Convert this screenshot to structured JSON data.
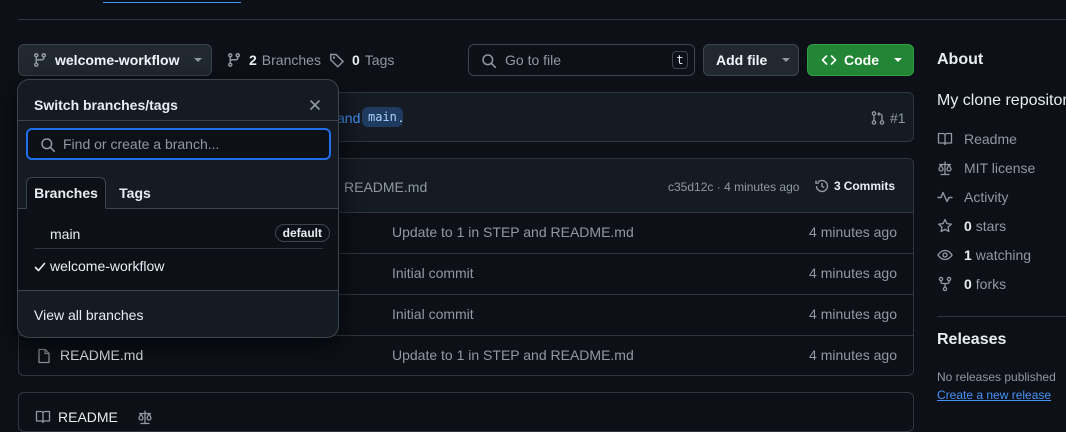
{
  "topbar": {
    "partial_link": ""
  },
  "branch_button": {
    "label": "welcome-workflow"
  },
  "branches_link": {
    "count": "2",
    "label": "Branches"
  },
  "tags_link": {
    "count": "0",
    "label": "Tags"
  },
  "search": {
    "placeholder": "Go to file",
    "shortcut": "t"
  },
  "add_file": {
    "label": "Add file"
  },
  "code_button": {
    "label": "Code"
  },
  "compare_banner": {
    "text_end": "and",
    "branch_chip": "main",
    "period": ".",
    "pr_number": "#1"
  },
  "commit_header": {
    "message_tail": "README.md",
    "hash": "c35d12c",
    "sep": "·",
    "time": "4 minutes ago",
    "commits_count": "3",
    "commits_label": "Commits"
  },
  "files": [
    {
      "name": "",
      "message": "Update to 1 in STEP and README.md",
      "time": "4 minutes ago"
    },
    {
      "name": "",
      "message": "Initial commit",
      "time": "4 minutes ago"
    },
    {
      "name": "",
      "message": "Initial commit",
      "time": "4 minutes ago"
    },
    {
      "name": "README.md",
      "message": "Update to 1 in STEP and README.md",
      "time": "4 minutes ago"
    }
  ],
  "readme_bar": {
    "label": "README"
  },
  "about": {
    "title": "About",
    "description": "My clone repositor",
    "readme": "Readme",
    "license": "MIT license",
    "activity": "Activity",
    "stars_count": "0",
    "stars_label": "stars",
    "watching_count": "1",
    "watching_label": "watching",
    "forks_count": "0",
    "forks_label": "forks"
  },
  "releases": {
    "title": "Releases",
    "none_text": "No releases published",
    "create_link": "Create a new release"
  },
  "dropdown": {
    "title": "Switch branches/tags",
    "filter_placeholder": "Find or create a branch...",
    "tabs": [
      "Branches",
      "Tags"
    ],
    "branches": [
      {
        "name": "main",
        "badge": "default",
        "selected": false
      },
      {
        "name": "welcome-workflow",
        "badge": "",
        "selected": true
      }
    ],
    "view_all": "View all branches"
  },
  "colors": {
    "bg": "#0d1117",
    "accent_blue": "#4493f8",
    "green": "#238636",
    "border": "#30363d"
  }
}
